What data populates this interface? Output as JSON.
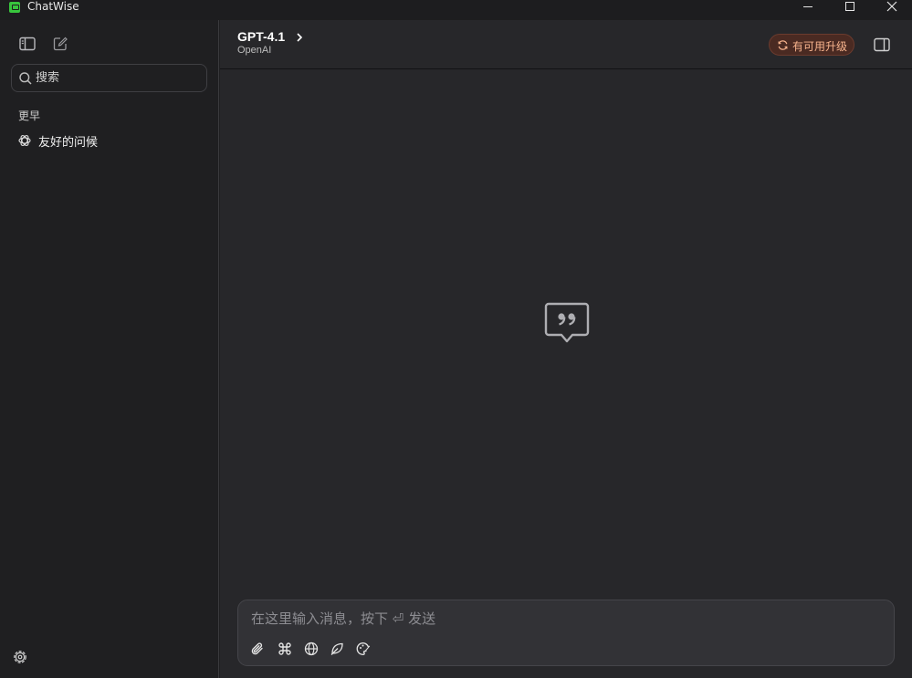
{
  "window": {
    "title": "ChatWise"
  },
  "sidebar": {
    "search_placeholder": "搜索",
    "section_label": "更早",
    "chats": [
      {
        "label": "友好的问候",
        "icon": "openai-icon"
      }
    ]
  },
  "header": {
    "model_name": "GPT-4.1",
    "provider": "OpenAI",
    "upgrade_label": "有可用升级"
  },
  "composer": {
    "placeholder": "在这里输入消息，按下 ⏎ 发送",
    "tools": [
      "attach-icon",
      "command-icon",
      "globe-icon",
      "leaf-icon",
      "palette-icon"
    ]
  },
  "colors": {
    "sidebar_bg": "#1f1f21",
    "main_bg": "#27272a",
    "composer_bg": "#323236",
    "upgrade_bg": "#4a2a22",
    "upgrade_text": "#f6b28c",
    "logo_green": "#38c53d"
  }
}
